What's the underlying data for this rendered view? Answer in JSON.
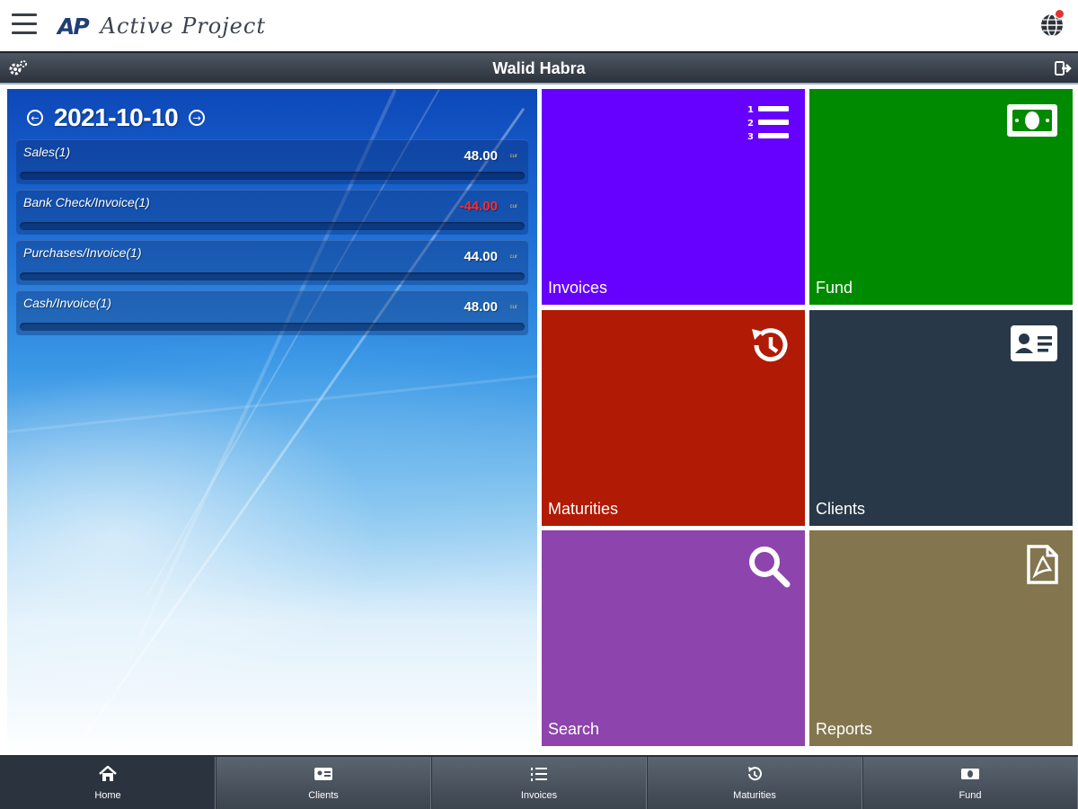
{
  "app": {
    "logo_mark": "AP",
    "logo_text": "Active Project"
  },
  "userbar": {
    "username": "Walid Habra"
  },
  "summary": {
    "date": "2021-10-10",
    "rows": [
      {
        "label": "Sales(1)",
        "amount": "48.00",
        "currency": "cur",
        "negative": false
      },
      {
        "label": "Bank Check/Invoice(1)",
        "amount": "-44.00",
        "currency": "cur",
        "negative": true
      },
      {
        "label": "Purchases/Invoice(1)",
        "amount": "44.00",
        "currency": "cur",
        "negative": false
      },
      {
        "label": "Cash/Invoice(1)",
        "amount": "48.00",
        "currency": "cur",
        "negative": false
      }
    ]
  },
  "tiles": [
    {
      "label": "Invoices",
      "icon": "numbered-list-icon",
      "color": "#6600ff"
    },
    {
      "label": "Fund",
      "icon": "banknote-icon",
      "color": "#008a00"
    },
    {
      "label": "Maturities",
      "icon": "history-icon",
      "color": "#b11a04"
    },
    {
      "label": "Clients",
      "icon": "id-card-icon",
      "color": "#283848"
    },
    {
      "label": "Search",
      "icon": "search-icon",
      "color": "#8d44ad"
    },
    {
      "label": "Reports",
      "icon": "pdf-file-icon",
      "color": "#83764f"
    }
  ],
  "tabbar": {
    "tabs": [
      {
        "label": "Home",
        "icon": "home-icon",
        "active": true
      },
      {
        "label": "Clients",
        "icon": "id-card-icon",
        "active": false
      },
      {
        "label": "Invoices",
        "icon": "numbered-list-icon",
        "active": false
      },
      {
        "label": "Maturities",
        "icon": "history-icon",
        "active": false
      },
      {
        "label": "Fund",
        "icon": "banknote-icon",
        "active": false
      }
    ]
  },
  "colors": {
    "negative_amount": "#ff2b2b",
    "userbar": "#3a424c",
    "tabbar": "#4b545e"
  }
}
